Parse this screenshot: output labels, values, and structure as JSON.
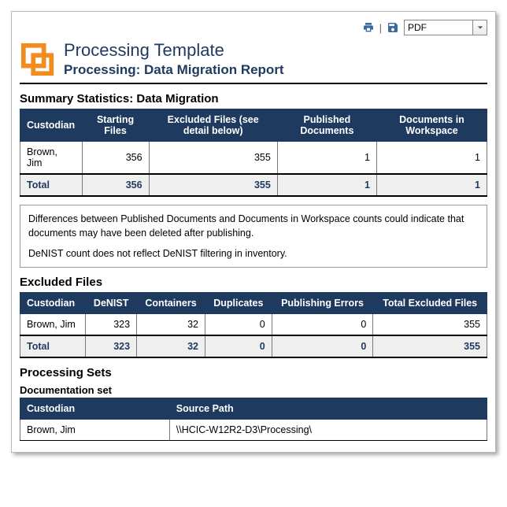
{
  "toolbar": {
    "export_format": "PDF"
  },
  "header": {
    "title": "Processing Template",
    "subtitle": "Processing: Data Migration Report"
  },
  "summary": {
    "title": "Summary Statistics: Data Migration",
    "columns": {
      "custodian": "Custodian",
      "starting": "Starting Files",
      "excluded": "Excluded Files (see detail below)",
      "published": "Published Documents",
      "workspace": "Documents in Workspace"
    },
    "rows": [
      {
        "custodian": "Brown, Jim",
        "starting": "356",
        "excluded": "355",
        "published": "1",
        "workspace": "1"
      }
    ],
    "total": {
      "label": "Total",
      "starting": "356",
      "excluded": "355",
      "published": "1",
      "workspace": "1"
    }
  },
  "note": {
    "p1": "Differences between Published Documents and Documents in Workspace counts could indicate that documents may have been deleted after publishing.",
    "p2": "DeNIST count does not reflect DeNIST filtering in inventory."
  },
  "excluded": {
    "title": "Excluded Files",
    "columns": {
      "custodian": "Custodian",
      "denist": "DeNIST",
      "containers": "Containers",
      "duplicates": "Duplicates",
      "pub_errors": "Publishing Errors",
      "total": "Total Excluded Files"
    },
    "rows": [
      {
        "custodian": "Brown, Jim",
        "denist": "323",
        "containers": "32",
        "duplicates": "0",
        "pub_errors": "0",
        "total": "355"
      }
    ],
    "total": {
      "label": "Total",
      "denist": "323",
      "containers": "32",
      "duplicates": "0",
      "pub_errors": "0",
      "total": "355"
    }
  },
  "sets": {
    "title": "Processing Sets",
    "set_name": "Documentation set",
    "columns": {
      "custodian": "Custodian",
      "source": "Source Path"
    },
    "rows": [
      {
        "custodian": "Brown, Jim",
        "source": "\\\\HCIC-W12R2-D3\\Processing\\"
      }
    ]
  }
}
